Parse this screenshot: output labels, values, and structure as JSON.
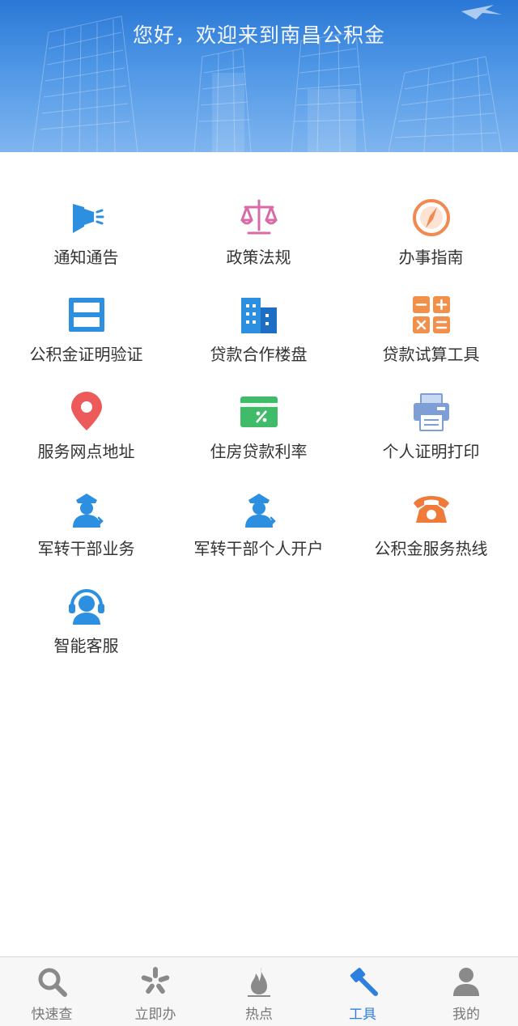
{
  "banner": {
    "title": "您好，欢迎来到南昌公积金"
  },
  "colors": {
    "brand_blue": "#2d7fe0",
    "tab_inactive": "#8a8a8a",
    "label": "#333333"
  },
  "services": [
    {
      "label": "通知通告",
      "icon": "megaphone-icon"
    },
    {
      "label": "政策法规",
      "icon": "scales-icon"
    },
    {
      "label": "办事指南",
      "icon": "compass-icon"
    },
    {
      "label": "公积金证明验证",
      "icon": "scan-icon"
    },
    {
      "label": "贷款合作楼盘",
      "icon": "building-icon"
    },
    {
      "label": "贷款试算工具",
      "icon": "calculator-icon"
    },
    {
      "label": "服务网点地址",
      "icon": "location-pin-icon"
    },
    {
      "label": "住房贷款利率",
      "icon": "rate-card-icon"
    },
    {
      "label": "个人证明打印",
      "icon": "printer-icon"
    },
    {
      "label": "军转干部业务",
      "icon": "officer-icon"
    },
    {
      "label": "军转干部个人开户",
      "icon": "officer-icon"
    },
    {
      "label": "公积金服务热线",
      "icon": "telephone-icon"
    },
    {
      "label": "智能客服",
      "icon": "headset-icon"
    }
  ],
  "tabbar": {
    "active": "工具",
    "tabs": [
      {
        "label": "快速查",
        "icon": "search-icon"
      },
      {
        "label": "立即办",
        "icon": "pinwheel-icon"
      },
      {
        "label": "热点",
        "icon": "flame-icon"
      },
      {
        "label": "工具",
        "icon": "hammer-icon"
      },
      {
        "label": "我的",
        "icon": "user-icon"
      }
    ]
  }
}
